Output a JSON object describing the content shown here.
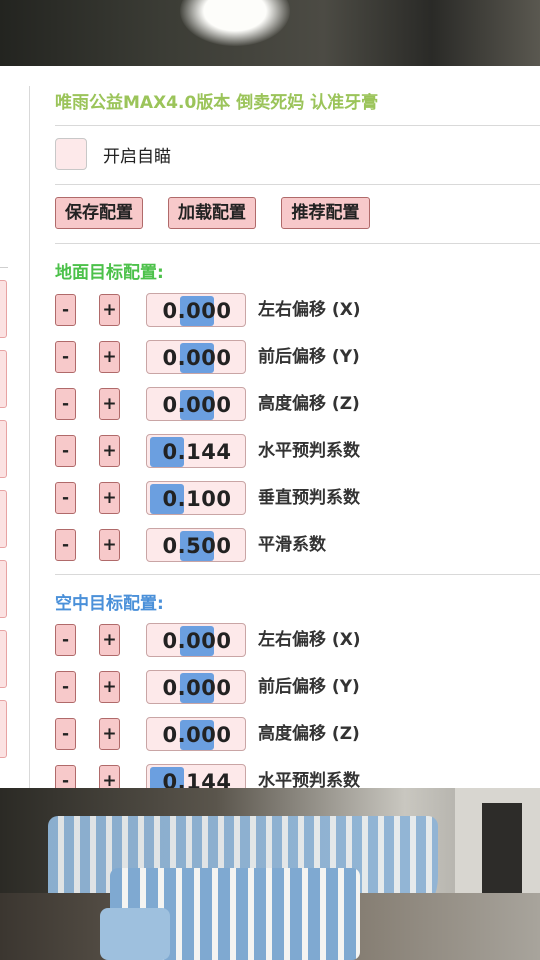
{
  "header": {
    "title": "唯雨公益MAX4.0版本 倒卖死妈 认准牙膏"
  },
  "auto_aim": {
    "label": "开启自瞄",
    "checked": false
  },
  "config_buttons": {
    "save": "保存配置",
    "load": "加载配置",
    "recommend": "推荐配置"
  },
  "controls": {
    "minus": "-",
    "plus": "+"
  },
  "ground": {
    "title": "地面目标配置:",
    "color": "#4cc14a",
    "params": [
      {
        "label": "左右偏移 (X)",
        "value": "0.000"
      },
      {
        "label": "前后偏移 (Y)",
        "value": "0.000"
      },
      {
        "label": "高度偏移 (Z)",
        "value": "0.000"
      },
      {
        "label": "水平预判系数",
        "value": "0.144"
      },
      {
        "label": "垂直预判系数",
        "value": "0.100"
      },
      {
        "label": "平滑系数",
        "value": "0.500"
      }
    ]
  },
  "air": {
    "title": "空中目标配置:",
    "color": "#4a90d9",
    "params": [
      {
        "label": "左右偏移 (X)",
        "value": "0.000"
      },
      {
        "label": "前后偏移 (Y)",
        "value": "0.000"
      },
      {
        "label": "高度偏移 (Z)",
        "value": "0.000"
      },
      {
        "label": "水平预判系数",
        "value": "0.144"
      }
    ]
  },
  "colors": {
    "title": "#9bc45a",
    "button_bg": "#f7c9ca",
    "field_bg": "#fde9ea",
    "slider_knob": "#6b9fe0"
  }
}
